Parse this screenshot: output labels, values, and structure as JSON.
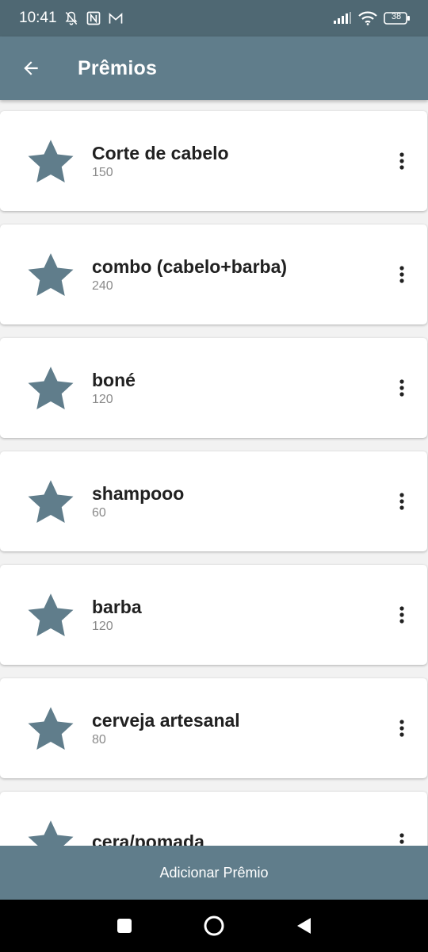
{
  "status_bar": {
    "time": "10:41",
    "battery": "38",
    "icons": [
      "notifications-off-icon",
      "nfc-icon",
      "gmail-icon",
      "signal-icon",
      "wifi-icon",
      "battery-icon"
    ]
  },
  "app_bar": {
    "title": "Prêmios",
    "back_icon": "arrow-back-icon"
  },
  "rewards": [
    {
      "name": "Corte de cabelo",
      "points": "150"
    },
    {
      "name": "combo (cabelo+barba)",
      "points": "240"
    },
    {
      "name": "boné",
      "points": "120"
    },
    {
      "name": "shampooo",
      "points": "60"
    },
    {
      "name": "barba",
      "points": "120"
    },
    {
      "name": "cerveja artesanal",
      "points": "80"
    },
    {
      "name": "cera/pomada",
      "points": ""
    }
  ],
  "bottom_button": {
    "label": "Adicionar Prêmio"
  },
  "colors": {
    "primary": "#607d8b",
    "status_bar": "#4f6873",
    "star": "#607d8b",
    "background": "#f2f2f2"
  },
  "nav_bar": {
    "icons": [
      "recents-square-icon",
      "home-circle-icon",
      "back-triangle-icon"
    ]
  }
}
